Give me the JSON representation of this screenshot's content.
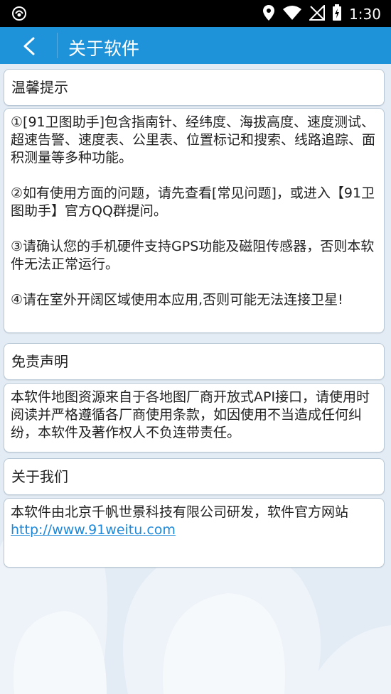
{
  "status_bar": {
    "time": "1:30",
    "icons": [
      "no-sim-icon",
      "location-icon",
      "wifi-icon",
      "signal-icon",
      "battery-charging-icon",
      "cast-icon"
    ]
  },
  "app_bar": {
    "title": "关于软件",
    "back_icon": "chevron-left-icon",
    "color": "#1f93da"
  },
  "sections": {
    "tips": {
      "heading": "温馨提示",
      "items": [
        "①[91卫图助手]包含指南针、经纬度、海拔高度、速度测试、超速告警、速度表、公里表、位置标记和搜索、线路追踪、面积测量等多种功能。",
        "②如有使用方面的问题，请先查看[常见问题]，或进入【91卫图助手】官方QQ群提问。",
        "③请确认您的手机硬件支持GPS功能及磁阻传感器，否则本软件无法正常运行。",
        "④请在室外开阔区域使用本应用,否则可能无法连接卫星!"
      ]
    },
    "disclaimer": {
      "heading": "免责声明",
      "text": "本软件地图资源来自于各地图厂商开放式API接口，请使用时阅读并严格遵循各厂商使用条款，如因使用不当造成任何纠纷，本软件及著作权人不负连带责任。"
    },
    "about": {
      "heading": "关于我们",
      "text": "本软件由北京千帆世景科技有限公司研发，软件官方网站",
      "link": "http://www.91weitu.com"
    }
  }
}
